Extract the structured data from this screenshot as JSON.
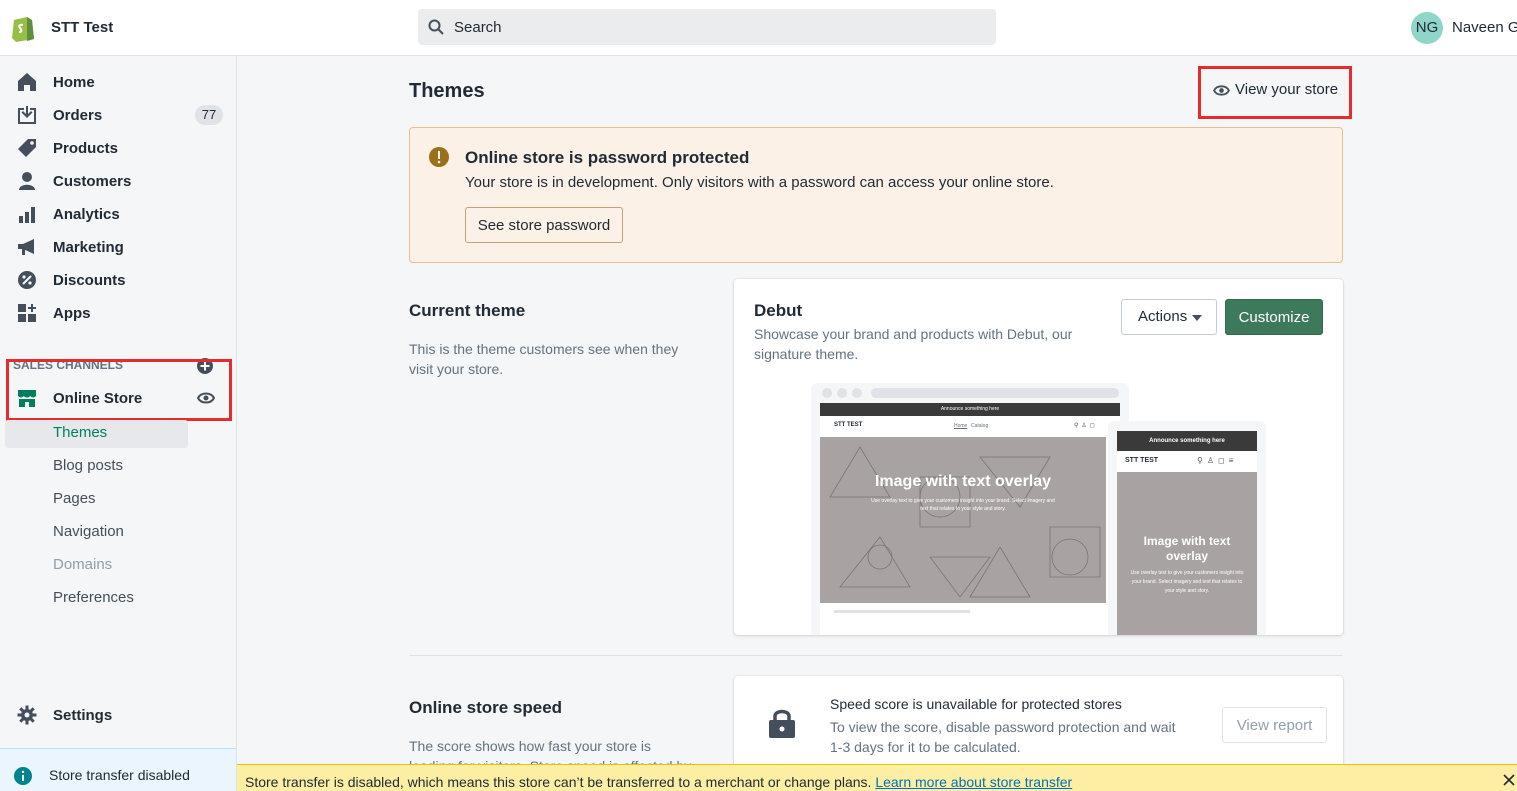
{
  "topbar": {
    "store_name": "STT Test",
    "search_placeholder": "Search",
    "avatar_initials": "NG",
    "user_name": "Naveen G"
  },
  "sidebar": {
    "items": [
      {
        "label": "Home"
      },
      {
        "label": "Orders",
        "badge": "77"
      },
      {
        "label": "Products"
      },
      {
        "label": "Customers"
      },
      {
        "label": "Analytics"
      },
      {
        "label": "Marketing"
      },
      {
        "label": "Discounts"
      },
      {
        "label": "Apps"
      }
    ],
    "sales_channels_heading": "SALES CHANNELS",
    "online_store": "Online Store",
    "subitems": [
      "Themes",
      "Blog posts",
      "Pages",
      "Navigation",
      "Domains",
      "Preferences"
    ],
    "settings": "Settings",
    "store_transfer": "Store transfer disabled"
  },
  "main": {
    "title": "Themes",
    "view_store": "View your store",
    "banner": {
      "title": "Online store is password protected",
      "desc": "Your store is in development. Only visitors with a password can access your online store.",
      "button": "See store password"
    },
    "current_theme": {
      "title": "Current theme",
      "desc": "This is the theme customers see when they visit your store."
    },
    "theme_card": {
      "name": "Debut",
      "desc": "Showcase your brand and products with Debut, our signature theme.",
      "actions": "Actions",
      "customize": "Customize"
    },
    "preview": {
      "announce": "Announce something here",
      "logo": "STT TEST",
      "nav_home": "Home",
      "nav_catalog": "Catalog",
      "hero_title": "Image with text overlay",
      "hero_desc": "Use overlay text to give your customers insight into your brand. Select imagery and text that relates to your style and story.",
      "mobile_announce": "Announce something here",
      "mobile_logo": "STT TEST",
      "mobile_hero_title": "Image with text overlay",
      "mobile_hero_desc": "Use overlay text to give your customers insight into your brand. Select imagery and text that relates to your style and story."
    },
    "speed": {
      "title": "Online store speed",
      "desc": "The score shows how fast your store is loading for visitors. Store speed is affected by",
      "card_title": "Speed score is unavailable for protected stores",
      "card_desc": "To view the score, disable password protection and wait 1-3 days for it to be calculated.",
      "button": "View report"
    }
  },
  "bottom_banner": {
    "message": "Store transfer is disabled, which means this store can’t be transferred to a merchant or change plans.",
    "link": "Learn more about store transfer"
  },
  "colors": {
    "accent": "#007f5f",
    "customize_bg": "#3d7a5b",
    "highlight": "#e52b2b",
    "warning_bg": "#fcf1e6",
    "transfer_bg": "#fcefa3"
  }
}
